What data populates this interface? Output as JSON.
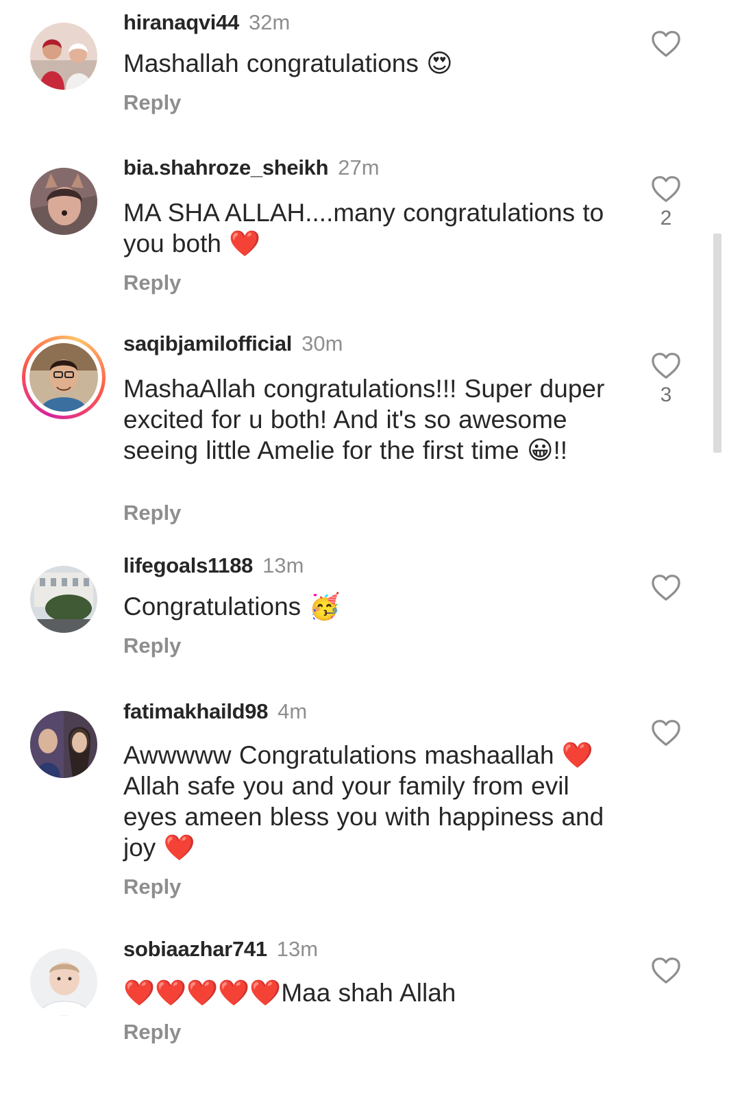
{
  "comments": [
    {
      "username": "hiranaqvi44",
      "time": "32m",
      "text": "Mashallah congratulations 😍",
      "reply": "Reply",
      "likes": "",
      "icons": {
        "like": "heart-outline-icon",
        "avatar": "avatar"
      }
    },
    {
      "username": "bia.shahroze_sheikh",
      "time": "27m",
      "text": "MA SHA ALLAH....many congratulations to you both ❤️",
      "reply": "Reply",
      "likes": "2"
    },
    {
      "username": "saqibjamilofficial",
      "time": "30m",
      "text": "MashaAllah congratulations!!! Super duper excited for u both! And it's so awesome seeing little Amelie for the first time 😀!!",
      "reply": "Reply",
      "likes": "3",
      "has_story_ring": true
    },
    {
      "username": "lifegoals1188",
      "time": "13m",
      "text": "Congratulations 🥳",
      "reply": "Reply",
      "likes": ""
    },
    {
      "username": "fatimakhaild98",
      "time": "4m",
      "text": "Awwwww Congratulations  mashaallah ❤️ Allah safe you and your  family from evil eyes  ameen  bless you  with  happiness and joy ❤️",
      "reply": "Reply",
      "likes": ""
    },
    {
      "username": "sobiaazhar741",
      "time": "13m",
      "text": "❤️❤️❤️❤️❤️Maa shah Allah",
      "reply": "Reply",
      "likes": ""
    }
  ],
  "colors": {
    "text": "#262626",
    "secondary": "#8e8e8e",
    "story_ring": [
      "#d6249f",
      "#fd5949",
      "#fdc468"
    ]
  }
}
